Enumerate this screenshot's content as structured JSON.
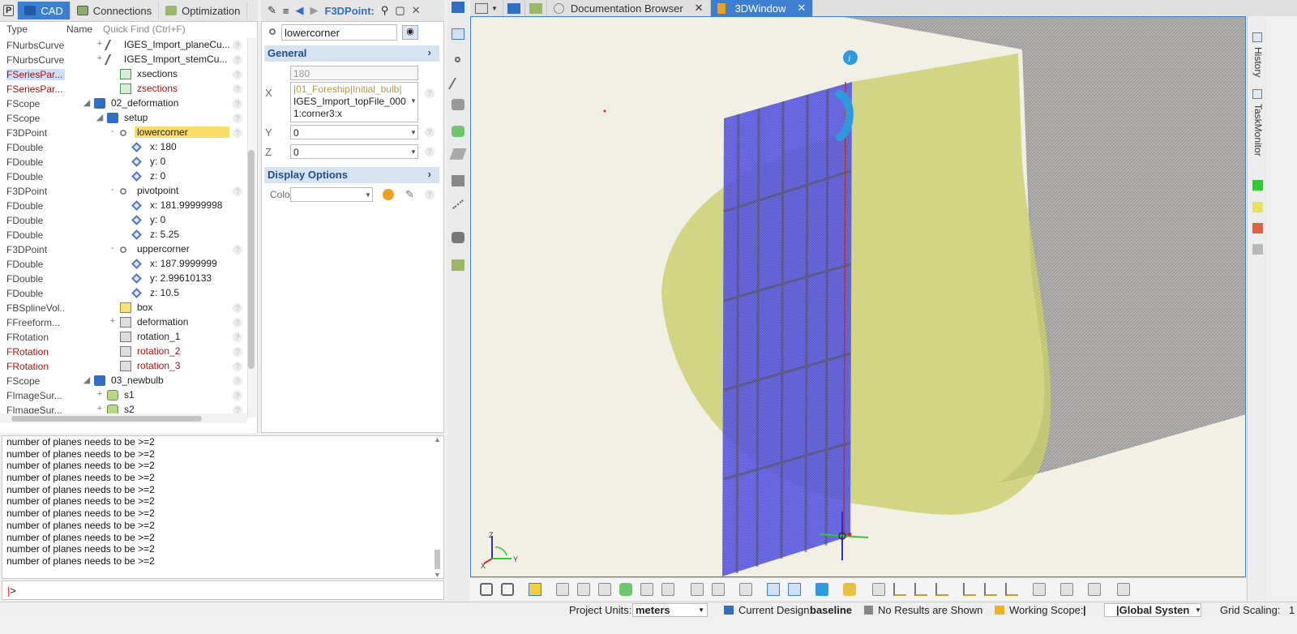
{
  "left_tabs": {
    "cad": "CAD",
    "connections": "Connections",
    "optimization": "Optimization"
  },
  "tree_header": {
    "type": "Type",
    "name": "Name",
    "quick_find": "Quick Find (Ctrl+F)"
  },
  "tree": [
    {
      "type": "FNurbsCurve",
      "name": "IGES_Import_planeCu...",
      "depth": 2,
      "toggle": "+",
      "icon": "curve"
    },
    {
      "type": "FNurbsCurve",
      "name": "IGES_Import_stemCu...",
      "depth": 2,
      "toggle": "+",
      "icon": "curve"
    },
    {
      "type": "FSeriesPar...",
      "name": "xsections",
      "depth": 3,
      "toggle": "",
      "icon": "sect",
      "style": "redhl"
    },
    {
      "type": "FSeriesPar...",
      "name": "zsections",
      "depth": 3,
      "toggle": "",
      "icon": "sect",
      "style": "red"
    },
    {
      "type": "FScope",
      "name": "02_deformation",
      "depth": 1,
      "toggle": "◢",
      "icon": "folder"
    },
    {
      "type": "FScope",
      "name": "setup",
      "depth": 2,
      "toggle": "◢",
      "icon": "folder"
    },
    {
      "type": "F3DPoint",
      "name": "lowercorner",
      "depth": 3,
      "toggle": "-",
      "icon": "pt",
      "style": "sel"
    },
    {
      "type": "FDouble",
      "name": "x: 180",
      "depth": 4,
      "toggle": "",
      "icon": "dbl"
    },
    {
      "type": "FDouble",
      "name": "y: 0",
      "depth": 4,
      "toggle": "",
      "icon": "dbl"
    },
    {
      "type": "FDouble",
      "name": "z: 0",
      "depth": 4,
      "toggle": "",
      "icon": "dbl"
    },
    {
      "type": "F3DPoint",
      "name": "pivotpoint",
      "depth": 3,
      "toggle": "-",
      "icon": "pt"
    },
    {
      "type": "FDouble",
      "name": "x: 181.99999998",
      "depth": 4,
      "toggle": "",
      "icon": "dbl"
    },
    {
      "type": "FDouble",
      "name": "y: 0",
      "depth": 4,
      "toggle": "",
      "icon": "dbl"
    },
    {
      "type": "FDouble",
      "name": "z: 5.25",
      "depth": 4,
      "toggle": "",
      "icon": "dbl"
    },
    {
      "type": "F3DPoint",
      "name": "uppercorner",
      "depth": 3,
      "toggle": "-",
      "icon": "pt"
    },
    {
      "type": "FDouble",
      "name": "x: 187.9999999",
      "depth": 4,
      "toggle": "",
      "icon": "dbl"
    },
    {
      "type": "FDouble",
      "name": "y: 2.99610133",
      "depth": 4,
      "toggle": "",
      "icon": "dbl"
    },
    {
      "type": "FDouble",
      "name": "z: 10.5",
      "depth": 4,
      "toggle": "",
      "icon": "dbl"
    },
    {
      "type": "FBSplineVol...",
      "name": "box",
      "depth": 3,
      "toggle": "",
      "icon": "box"
    },
    {
      "type": "FFreeform...",
      "name": "deformation",
      "depth": 3,
      "toggle": "+",
      "icon": "rot"
    },
    {
      "type": "FRotation",
      "name": "rotation_1",
      "depth": 3,
      "toggle": "",
      "icon": "rot"
    },
    {
      "type": "FRotation",
      "name": "rotation_2",
      "depth": 3,
      "toggle": "",
      "icon": "rot",
      "style": "red"
    },
    {
      "type": "FRotation",
      "name": "rotation_3",
      "depth": 3,
      "toggle": "",
      "icon": "rot",
      "style": "red"
    },
    {
      "type": "FScope",
      "name": "03_newbulb",
      "depth": 1,
      "toggle": "◢",
      "icon": "folder"
    },
    {
      "type": "FImageSur...",
      "name": "s1",
      "depth": 2,
      "toggle": "+",
      "icon": "surf"
    },
    {
      "type": "FImageSur...",
      "name": "s2",
      "depth": 2,
      "toggle": "+",
      "icon": "surf"
    }
  ],
  "props": {
    "title": "F3DPoint:",
    "object_name": "lowercorner",
    "general": "General",
    "x_label": "X",
    "x_value": "180",
    "x_expr_1": "|01_Foreship|Initial_bulb|",
    "x_expr_2": "IGES_Import_topFile_000",
    "x_expr_3": "1:corner3:x",
    "y_label": "Y",
    "y_value": "0",
    "z_label": "Z",
    "z_value": "0",
    "display_options": "Display Options",
    "color_label": "Color"
  },
  "console": {
    "lines": [
      "number of planes needs to be >=2",
      "number of planes needs to be >=2",
      "number of planes needs to be >=2",
      "number of planes needs to be >=2",
      "number of planes needs to be >=2",
      "number of planes needs to be >=2",
      "number of planes needs to be >=2",
      "number of planes needs to be >=2",
      "number of planes needs to be >=2",
      "number of planes needs to be >=2",
      "number of planes needs to be >=2"
    ],
    "prompt": ">"
  },
  "view_tabs": {
    "doc": "Documentation Browser",
    "win3d": "3DWindow"
  },
  "axes": {
    "z": "Z",
    "y": "Y",
    "x": "X"
  },
  "right_side": {
    "history": "History",
    "taskmonitor": "TaskMonitor"
  },
  "colors": {
    "accent": "#3b7fd0",
    "hull": "#8e8e8e",
    "bulb": "#c9cf6a",
    "box": "#4040c8",
    "green": "#2ecc2e",
    "yellow": "#e8e05a",
    "orange": "#e0623a",
    "grey": "#b8b8b8"
  },
  "status": {
    "units_label": "Project Units:",
    "units_value": "meters",
    "design_label": "Current Design:",
    "design_value": "baseline",
    "results": "No Results are Shown",
    "scope_label": "Working Scope:",
    "scope_value": "|",
    "system_value": "|Global Systen",
    "grid_label": "Grid Scaling:",
    "grid_value": "1"
  }
}
